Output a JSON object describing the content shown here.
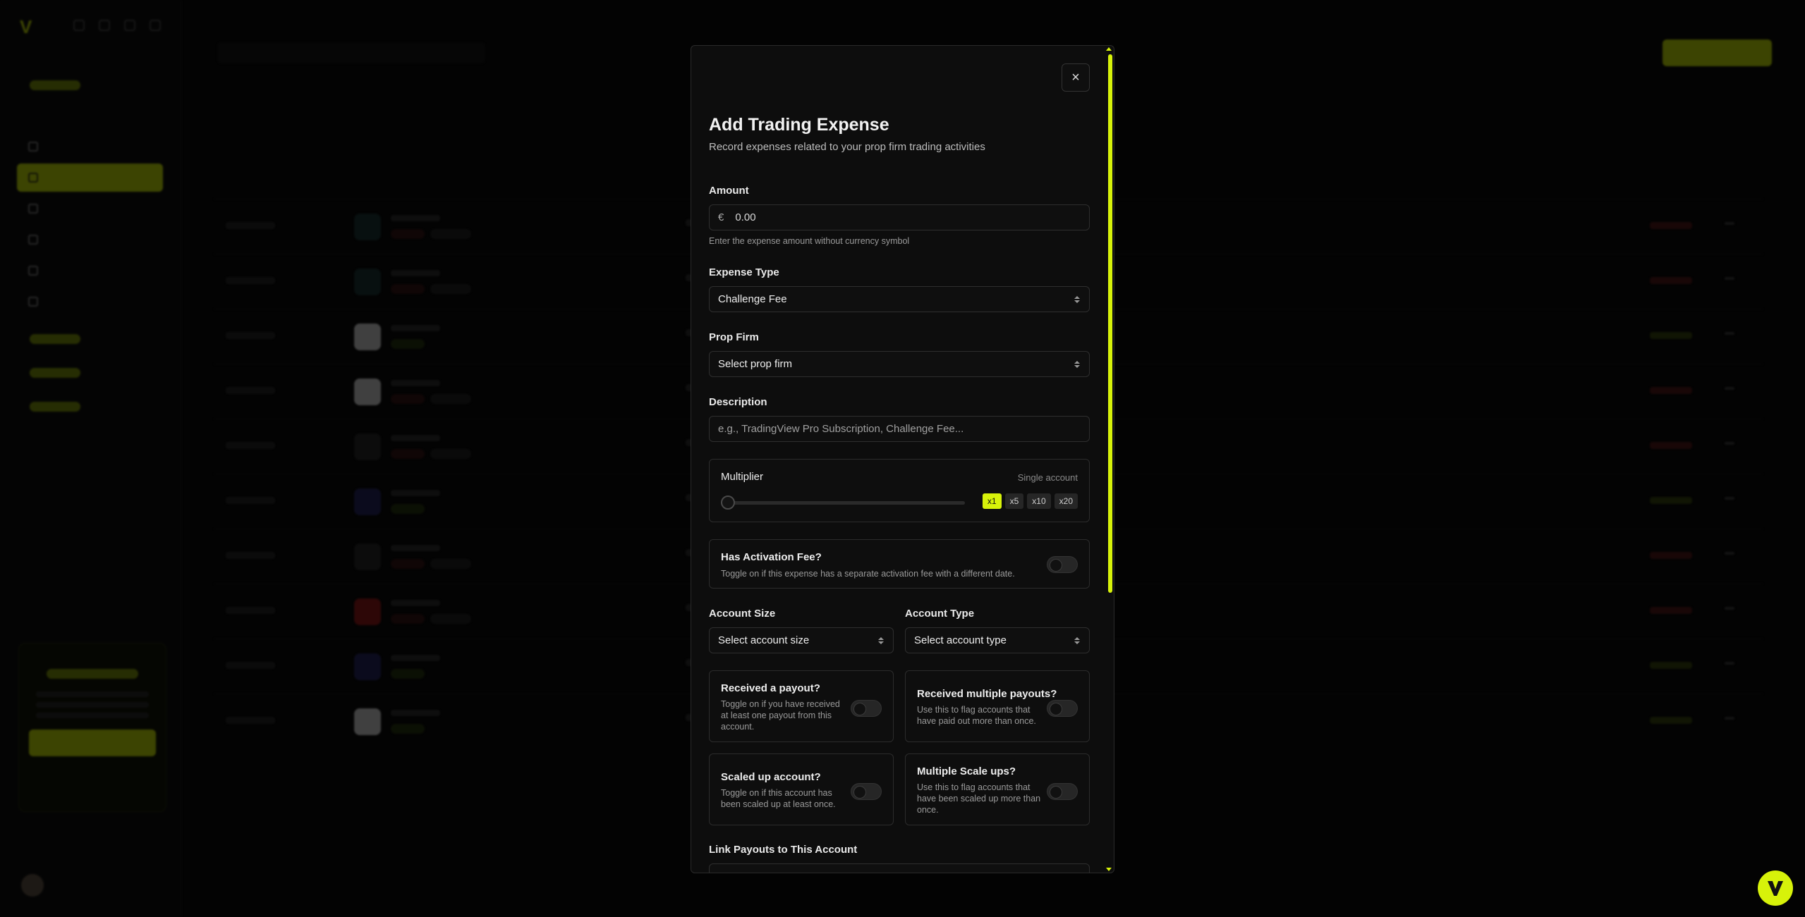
{
  "modal": {
    "title": "Add Trading Expense",
    "subtitle": "Record expenses related to your prop firm trading activities",
    "close_icon": "×",
    "amount": {
      "label": "Amount",
      "currency": "€",
      "value": "0.00",
      "hint": "Enter the expense amount without currency symbol"
    },
    "expense_type": {
      "label": "Expense Type",
      "value": "Challenge Fee"
    },
    "prop_firm": {
      "label": "Prop Firm",
      "value": "Select prop firm"
    },
    "description": {
      "label": "Description",
      "placeholder": "e.g., TradingView Pro Subscription, Challenge Fee..."
    },
    "multiplier": {
      "label": "Multiplier",
      "note": "Single account",
      "options": [
        "x1",
        "x5",
        "x10",
        "x20"
      ],
      "selected": "x1"
    },
    "activation_fee": {
      "title": "Has Activation Fee?",
      "desc": "Toggle on if this expense has a separate activation fee with a different date."
    },
    "account_size": {
      "label": "Account Size",
      "value": "Select account size"
    },
    "account_type": {
      "label": "Account Type",
      "value": "Select account type"
    },
    "payout": {
      "title": "Received a payout?",
      "desc": "Toggle on if you have received at least one payout from this account."
    },
    "multiple_payouts": {
      "title": "Received multiple payouts?",
      "desc": "Use this to flag accounts that have paid out more than once."
    },
    "scaled_up": {
      "title": "Scaled up account?",
      "desc": "Toggle on if this account has been scaled up at least once."
    },
    "multiple_scale": {
      "title": "Multiple Scale ups?",
      "desc": "Use this to flag accounts that have been scaled up more than once."
    },
    "link_payouts": {
      "label": "Link Payouts to This Account"
    }
  },
  "icons": {
    "close": "close-icon",
    "chevron": "chevron-updown-icon",
    "fab": "brand-logo-icon"
  },
  "colors": {
    "accent": "#d7f20a",
    "background": "#0b0b0b",
    "modal_bg": "#0d0d0d"
  }
}
